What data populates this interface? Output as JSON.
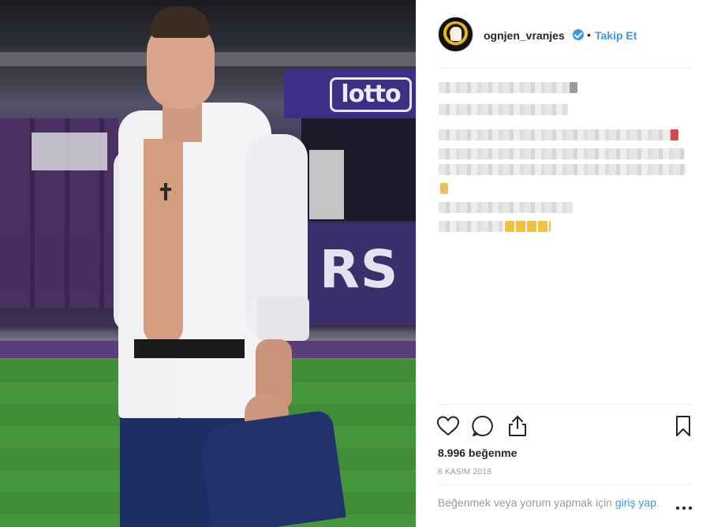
{
  "post": {
    "username": "ognjen_vranjes",
    "separator": "•",
    "follow_label": "Takip Et",
    "likes_text": "8.996 beğenme",
    "date_text": "8 KASIM 2018",
    "login_prompt_prefix": "Beğenmek veya yorum yapmak için ",
    "login_link": "giriş yap",
    "login_prompt_suffix": "."
  },
  "photo": {
    "board_logo_text": "lotto",
    "board_letters": "RS"
  },
  "icons": {
    "like": "heart-icon",
    "comment": "comment-icon",
    "share": "share-icon",
    "save": "bookmark-icon",
    "more": "more-options-icon",
    "verified": "verified-badge-icon"
  },
  "colors": {
    "link_blue": "#3897f0",
    "text_primary": "#262626",
    "text_secondary": "#999999",
    "divider": "#efefef"
  }
}
